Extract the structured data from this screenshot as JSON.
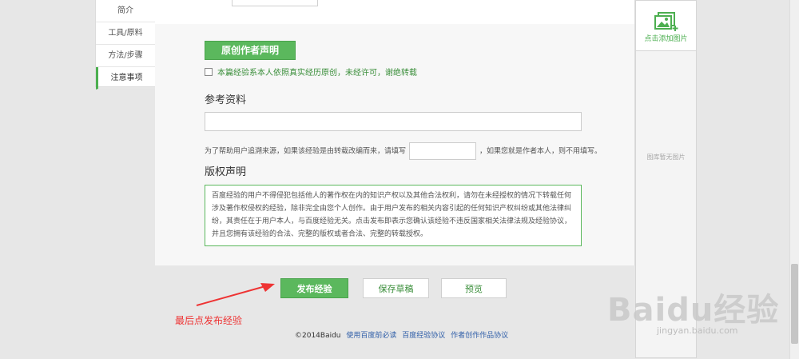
{
  "nav": {
    "items": [
      "简介",
      "工具/原料",
      "方法/步骤",
      "注意事项"
    ],
    "active_index": 3
  },
  "original": {
    "button_label": "原创作者声明",
    "checkbox_label": "本篇经验系本人依照真实经历原创，未经许可，谢绝转载",
    "checked": false
  },
  "reference": {
    "title": "参考资料",
    "hint_before": "为了帮助用户追溯来源，如果该经验是由转载改编而来，请填写",
    "hint_after": "，如果您就是作者本人，则不用填写。"
  },
  "copyright": {
    "title": "版权声明",
    "text": "百度经验的用户不得侵犯包括他人的著作权在内的知识产权以及其他合法权利，请勿在未经授权的情况下转载任何涉及著作权侵权的经验，除非完全由您个人创作。由于用户发布的相关内容引起的任何知识产权纠纷或其他法律纠纷，其责任在于用户本人，与百度经验无关。点击发布即表示您确认该经验不违反国家相关法律法规及经验协议，并且您拥有该经验的合法、完整的版权或者合法、完整的转载授权。"
  },
  "actions": {
    "publish": "发布经验",
    "save_draft": "保存草稿",
    "preview": "预览"
  },
  "annotation": "最后点发布经验",
  "footer": {
    "copyright": "©2014Baidu",
    "links": [
      "使用百度前必读",
      "百度经验协议",
      "作者创作作品协议"
    ]
  },
  "right_panel": {
    "add_image": "点击添加图片",
    "empty": "图库暂无图片"
  },
  "watermark": {
    "logo": "Baidu经验",
    "url": "jingyan.baidu.com"
  },
  "colors": {
    "accent": "#5bb85d",
    "annotation": "#ee3333",
    "link": "#2f5ea8"
  }
}
